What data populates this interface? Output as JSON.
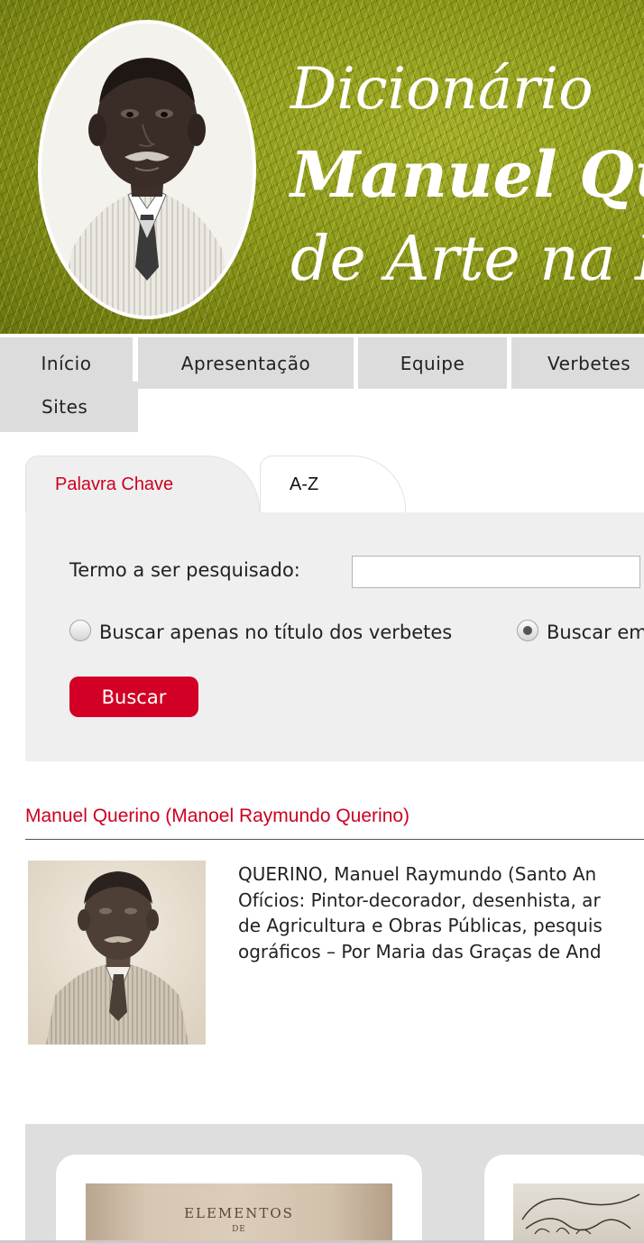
{
  "banner": {
    "title_line1": "Dicionário",
    "title_line2": "Manuel Qu",
    "title_line3": "de Arte na B"
  },
  "nav": {
    "items": [
      "Início",
      "Apresentação",
      "Equipe",
      "Verbetes",
      "Sites"
    ]
  },
  "search": {
    "tabs": [
      "Palavra Chave",
      "A-Z"
    ],
    "active_tab": "Palavra Chave",
    "term_label": "Termo a ser pesquisado:",
    "term_value": "",
    "radio_title_only": "Buscar apenas no título dos verbetes",
    "radio_all": "Buscar em",
    "selected_radio": "Buscar em",
    "button_label": "Buscar"
  },
  "entry": {
    "title": "Manuel Querino (Manoel Raymundo Querino)",
    "lines": [
      "QUERINO, Manuel Raymundo (Santo An",
      "Ofícios: Pintor-decorador, desenhista, ar",
      "de Agricultura e Obras Públicas, pesquis",
      "ográficos – Por Maria das Graças de And"
    ]
  },
  "gallery": {
    "book1_text": "ELEMENTOS",
    "book1_sub": "DE"
  },
  "colors": {
    "accent_red": "#d10024",
    "banner_green": "#8e9a1c",
    "nav_gray": "#dcdcdc",
    "panel_gray": "#efefef"
  }
}
